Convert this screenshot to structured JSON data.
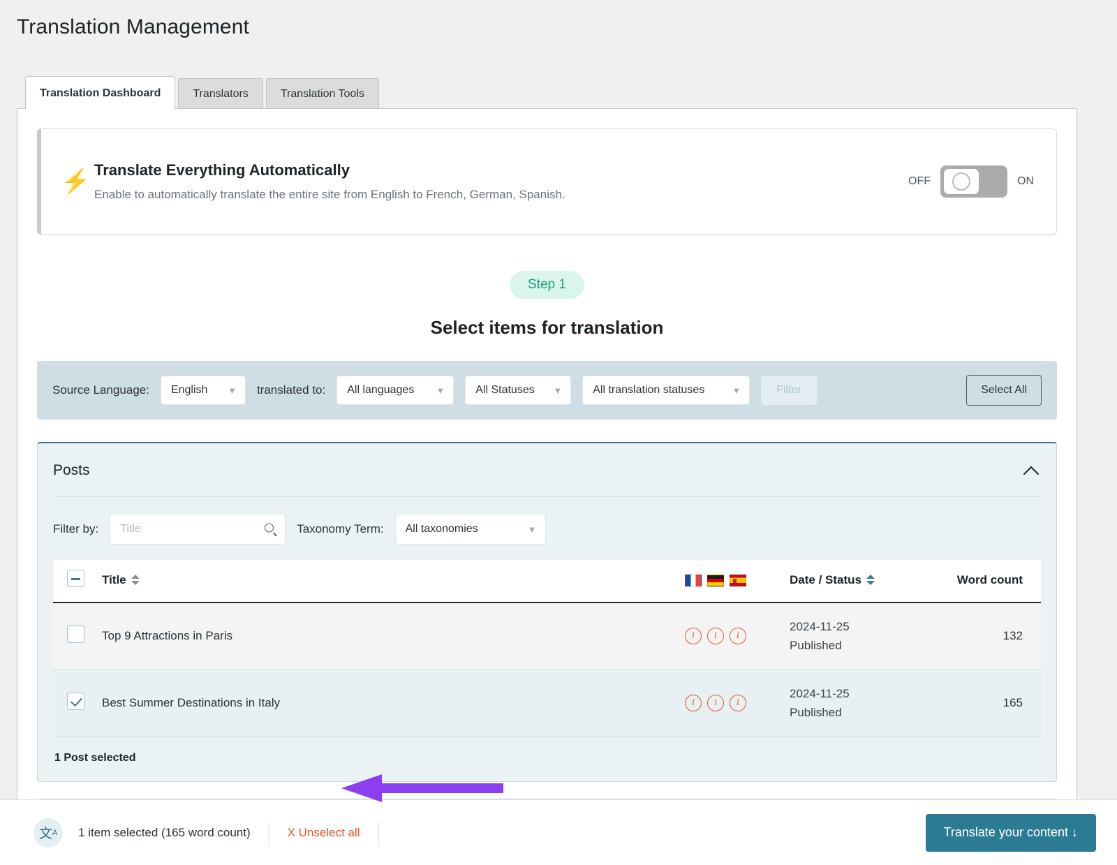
{
  "page": {
    "title": "Translation Management"
  },
  "tabs": [
    {
      "label": "Translation Dashboard",
      "active": true
    },
    {
      "label": "Translators",
      "active": false
    },
    {
      "label": "Translation Tools",
      "active": false
    }
  ],
  "auto_banner": {
    "icon": "bolt-icon",
    "title": "Translate Everything Automatically",
    "subtitle": "Enable to automatically translate the entire site from English to French, German, Spanish.",
    "toggle_off_label": "OFF",
    "toggle_on_label": "ON",
    "toggle_state": "off"
  },
  "step": {
    "badge": "Step 1",
    "heading": "Select items for translation"
  },
  "filter_bar": {
    "source_language_label": "Source Language:",
    "source_language_value": "English",
    "translated_to_label": "translated to:",
    "languages_value": "All languages",
    "statuses_value": "All Statuses",
    "translation_statuses_value": "All translation statuses",
    "filter_button": "Filter",
    "select_all_button": "Select All"
  },
  "posts_panel": {
    "title": "Posts",
    "collapse_icon": "chevron-up-icon",
    "filter_by_label": "Filter by:",
    "title_search_placeholder": "Title",
    "title_search_value": "",
    "taxonomy_label": "Taxonomy Term:",
    "taxonomy_value": "All taxonomies",
    "columns": {
      "title": "Title",
      "date_status": "Date / Status",
      "word_count": "Word count"
    },
    "flags": [
      {
        "name": "flag-fr",
        "title": "French"
      },
      {
        "name": "flag-de",
        "title": "German"
      },
      {
        "name": "flag-es",
        "title": "Spanish"
      }
    ],
    "rows": [
      {
        "title": "Top 9 Attractions in Paris",
        "checked": false,
        "date": "2024-11-25",
        "status": "Published",
        "word_count": "132",
        "info_icons": 3
      },
      {
        "title": "Best Summer Destinations in Italy",
        "checked": true,
        "date": "2024-11-25",
        "status": "Published",
        "word_count": "165",
        "info_icons": 3
      }
    ],
    "footer": "1 Post selected"
  },
  "bottom_bar": {
    "icon": "translate-icon",
    "selection_text": "1 item selected (165 word count)",
    "unselect_label": "X Unselect all",
    "translate_button": "Translate your content ↓"
  },
  "colors": {
    "accent_teal": "#2a7b93",
    "step_badge_text": "#1aa179",
    "step_badge_bg": "#d9f5ec",
    "filter_bar_bg": "#cfdee4",
    "panel_bg": "#eaf2f4",
    "info_icon": "#e8562a",
    "unselect_link": "#e8562a",
    "word_count": "#4c7b8e",
    "annotation_arrow": "#8b3ff0"
  }
}
